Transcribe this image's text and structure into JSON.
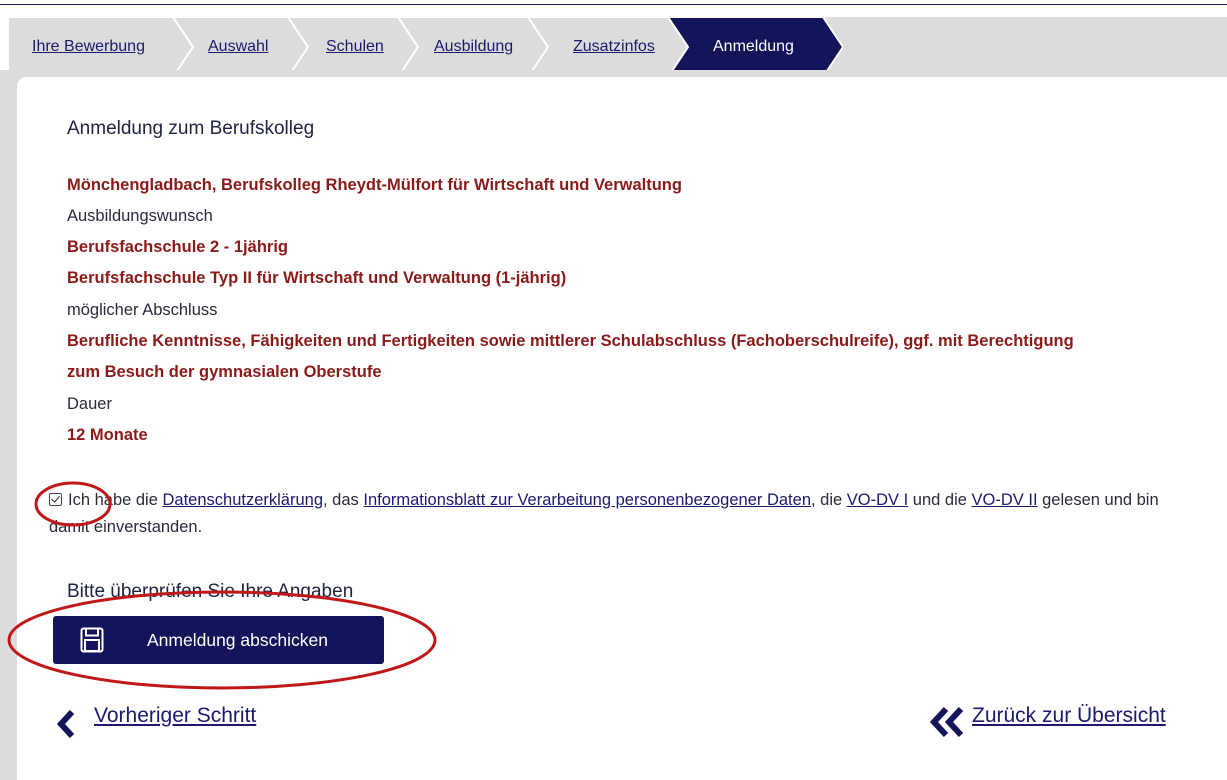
{
  "steps": [
    {
      "label": "Ihre Bewerbung",
      "active": false
    },
    {
      "label": "Auswahl",
      "active": false
    },
    {
      "label": "Schulen",
      "active": false
    },
    {
      "label": "Ausbildung",
      "active": false
    },
    {
      "label": "Zusatzinfos",
      "active": false
    },
    {
      "label": "Anmeldung",
      "active": true
    }
  ],
  "main": {
    "heading": "Anmeldung zum Berufskolleg",
    "school": "Mönchengladbach, Berufskolleg Rheydt-Mülfort für Wirtschaft und Verwaltung",
    "wish_label": "Ausbildungswunsch",
    "wish_value_1": "Berufsfachschule 2 - 1jährig",
    "wish_value_2": "Berufsfachschule Typ II für Wirtschaft und Verwaltung (1-jährig)",
    "degree_label": "möglicher Abschluss",
    "degree_line_1": "Berufliche Kenntnisse, Fähigkeiten und Fertigkeiten sowie mittlerer Schulabschluss (Fachoberschulreife), ggf. mit Berechtigung",
    "degree_line_2": "zum Besuch der gymnasialen Oberstufe",
    "duration_label": "Dauer",
    "duration_value": "12 Monate"
  },
  "consent": {
    "checked": true,
    "text_1": "Ich habe die ",
    "link_privacy": "Datenschutzerklärung",
    "text_2": ", das ",
    "link_infosheet": "Informationsblatt zur Verarbeitung personenbezogener Daten",
    "text_3": ", die ",
    "link_vo1": "VO-DV I",
    "text_4": " und die ",
    "link_vo2": "VO-DV II",
    "text_5": " gelesen und bin damit einverstanden."
  },
  "review_text": "Bitte überprüfen Sie Ihre Angaben",
  "submit_label": "Anmeldung abschicken",
  "nav": {
    "prev_label": "Vorheriger Schritt",
    "overview_label": "Zurück zur Übersicht"
  },
  "colors": {
    "primary": "#14145a",
    "highlight": "#8b1a1a",
    "annotation": "#c01818",
    "step_bg": "#dcdcdc"
  },
  "icons": [
    "save-icon",
    "chevron-left-icon",
    "double-chevron-left-icon",
    "check-icon"
  ]
}
